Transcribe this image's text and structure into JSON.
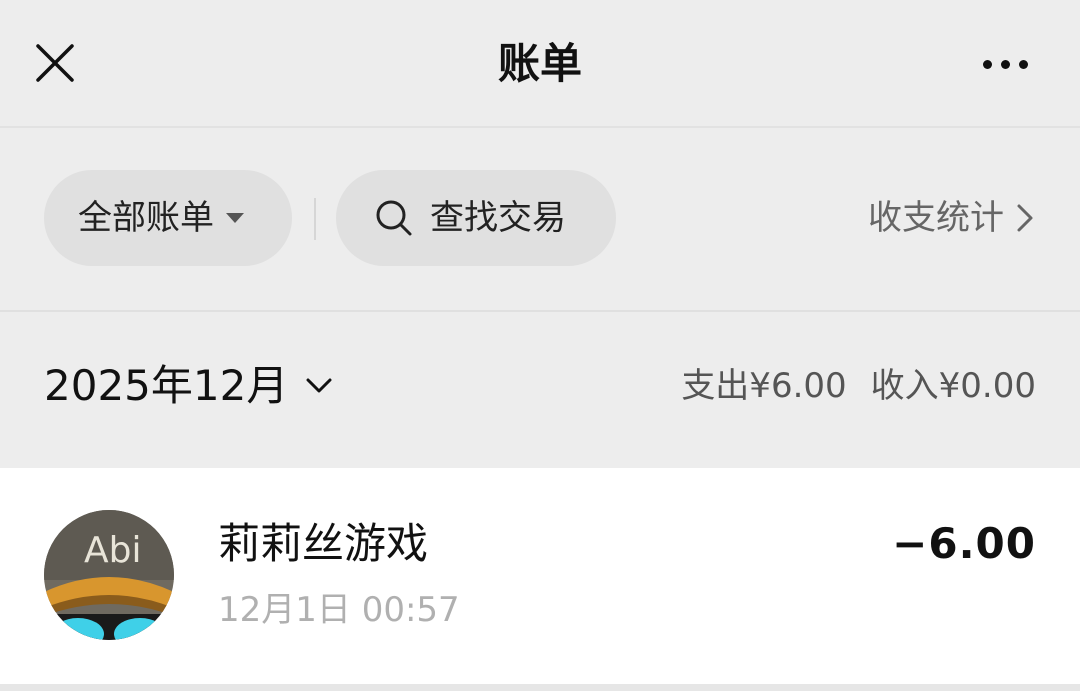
{
  "header": {
    "title": "账单",
    "close_icon": "close-icon",
    "more_icon": "more-horizontal-icon"
  },
  "filters": {
    "all_bills_label": "全部账单",
    "search_label": "查找交易",
    "search_icon": "search-icon",
    "stats_label": "收支统计"
  },
  "month": {
    "label": "2025年12月",
    "expense": "支出¥6.00",
    "income": "收入¥0.00"
  },
  "transactions": [
    {
      "merchant": "莉莉丝游戏",
      "time": "12月1日 00:57",
      "amount": "−6.00",
      "avatar_text": "Abi"
    }
  ],
  "colors": {
    "background": "#ededed",
    "pill": "#e0e0e0",
    "list_background": "#ffffff",
    "muted_text": "#b0b0b0",
    "secondary_text": "#666666"
  }
}
